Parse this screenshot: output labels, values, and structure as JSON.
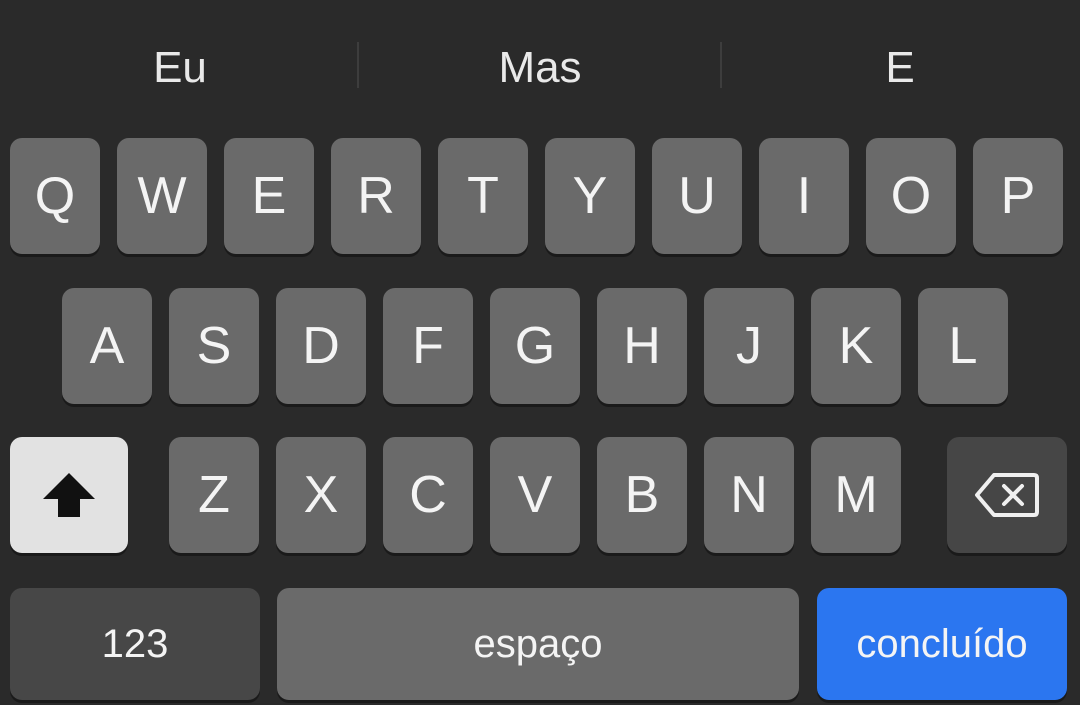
{
  "suggestions": [
    "Eu",
    "Mas",
    "E"
  ],
  "rows": {
    "row1": [
      "Q",
      "W",
      "E",
      "R",
      "T",
      "Y",
      "U",
      "I",
      "O",
      "P"
    ],
    "row2": [
      "A",
      "S",
      "D",
      "F",
      "G",
      "H",
      "J",
      "K",
      "L"
    ],
    "row3": [
      "Z",
      "X",
      "C",
      "V",
      "B",
      "N",
      "M"
    ]
  },
  "bottom": {
    "numbers_label": "123",
    "space_label": "espaço",
    "done_label": "concluído"
  },
  "icons": {
    "shift": "shift-arrow-up-filled",
    "delete": "backspace-delete"
  },
  "colors": {
    "background": "#2a2a2a",
    "key": "#6a6a6a",
    "shift_active": "#e2e2e2",
    "done_accent": "#2b76f0"
  }
}
